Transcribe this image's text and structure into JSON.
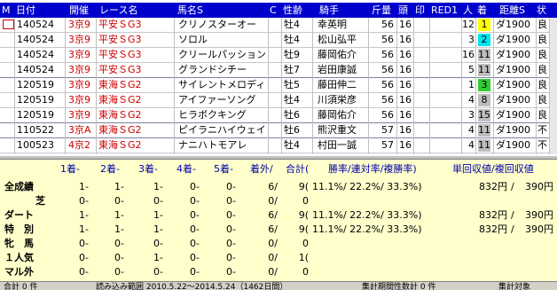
{
  "columns": {
    "m": "M",
    "date": "日付",
    "venue": "開催",
    "race": "レース名",
    "horse": "馬名S",
    "c": "C",
    "sexage": "性齢",
    "jockey": "騎手",
    "weight": "斤量",
    "head": "頭",
    "mark": "印",
    "red1": "RED1",
    "pop": "人",
    "finish": "着",
    "distance": "距離S",
    "cond": "状"
  },
  "colors": {
    "header_bg": "#0000cc",
    "first": "#ffff00",
    "second": "#00e5ee",
    "third": "#33cc33",
    "other": "#bdbdbd",
    "summary_bg": "#ffffcc"
  },
  "rows": [
    {
      "date": "140524",
      "venue": "3京9",
      "race": "平安ＳG3",
      "horse": "クリノスターオー",
      "sexage": "牡4",
      "jockey": "幸英明",
      "weight": "56",
      "head": "16",
      "pop": "12",
      "finish": "1",
      "distance": "ダ1900",
      "cond": "良",
      "finish_class": "b1"
    },
    {
      "date": "140524",
      "venue": "3京9",
      "race": "平安ＳG3",
      "horse": "ソロル",
      "sexage": "牡4",
      "jockey": "松山弘平",
      "weight": "56",
      "head": "16",
      "pop": "3",
      "finish": "2",
      "distance": "ダ1900",
      "cond": "良",
      "finish_class": "b2"
    },
    {
      "date": "140524",
      "venue": "3京9",
      "race": "平安ＳG3",
      "horse": "クリールパッション",
      "sexage": "牡9",
      "jockey": "藤岡佑介",
      "weight": "56",
      "head": "16",
      "pop": "16",
      "finish": "11",
      "distance": "ダ1900",
      "cond": "良",
      "finish_class": "bn"
    },
    {
      "date": "140524",
      "venue": "3京9",
      "race": "平安ＳG3",
      "horse": "グランドシチー",
      "sexage": "牡7",
      "jockey": "岩田康誠",
      "weight": "56",
      "head": "16",
      "pop": "5",
      "finish": "11",
      "distance": "ダ1900",
      "cond": "良",
      "finish_class": "bn"
    },
    {
      "date": "120519",
      "venue": "3京9",
      "race": "東海ＳG2",
      "horse": "サイレントメロディ",
      "sexage": "牡5",
      "jockey": "藤田伸二",
      "weight": "56",
      "head": "16",
      "pop": "1",
      "finish": "3",
      "distance": "ダ1900",
      "cond": "良",
      "finish_class": "b3"
    },
    {
      "date": "120519",
      "venue": "3京9",
      "race": "東海ＳG2",
      "horse": "アイファーソング",
      "sexage": "牡4",
      "jockey": "川須栄彦",
      "weight": "56",
      "head": "16",
      "pop": "4",
      "finish": "8",
      "distance": "ダ1900",
      "cond": "良",
      "finish_class": "bn"
    },
    {
      "date": "120519",
      "venue": "3京9",
      "race": "東海ＳG2",
      "horse": "ヒラボクキング",
      "sexage": "牡6",
      "jockey": "藤岡佑介",
      "weight": "56",
      "head": "16",
      "pop": "3",
      "finish": "15",
      "distance": "ダ1900",
      "cond": "良",
      "finish_class": "bn"
    },
    {
      "date": "110522",
      "venue": "3京A",
      "race": "東海ＳG2",
      "horse": "ピイラニハイウェイ",
      "sexage": "牡6",
      "jockey": "熊沢重文",
      "weight": "57",
      "head": "16",
      "pop": "4",
      "finish": "11",
      "distance": "ダ1900",
      "cond": "不",
      "finish_class": "bn"
    },
    {
      "date": "100523",
      "venue": "4京2",
      "race": "東海ＳG2",
      "horse": "ナニハトモアレ",
      "sexage": "牡4",
      "jockey": "村田一誠",
      "weight": "57",
      "head": "16",
      "pop": "4",
      "finish": "11",
      "distance": "ダ1900",
      "cond": "不",
      "finish_class": "bn"
    }
  ],
  "summary": {
    "headers": {
      "h1": "1着-",
      "h2": "2着-",
      "h3": "3着-",
      "h4": "4着-",
      "h5": "5着-",
      "h6": "着外/",
      "total": "合計(",
      "rates": "勝率/連対率/複勝率)",
      "ret": "単回収値/複回収値"
    },
    "rows": [
      {
        "label": "全成績",
        "c1": "1-",
        "c2": "1-",
        "c3": "1-",
        "c4": "0-",
        "c5": "0-",
        "c6": "6/",
        "total": "9(",
        "rates": "11.1%/ 22.2%/ 33.3%)",
        "win": "832円",
        "place": "390円",
        "sep": "/"
      },
      {
        "label": "芝",
        "c1": "0-",
        "c2": "0-",
        "c3": "0-",
        "c4": "0-",
        "c5": "0-",
        "c6": "0/",
        "total": "0",
        "rates": "",
        "win": "",
        "place": "",
        "sep": ""
      },
      {
        "label": "ダート",
        "c1": "1-",
        "c2": "1-",
        "c3": "1-",
        "c4": "0-",
        "c5": "0-",
        "c6": "6/",
        "total": "9(",
        "rates": "11.1%/ 22.2%/ 33.3%)",
        "win": "832円",
        "place": "390円",
        "sep": "/"
      },
      {
        "label": "特　別",
        "c1": "1-",
        "c2": "1-",
        "c3": "1-",
        "c4": "0-",
        "c5": "0-",
        "c6": "6/",
        "total": "9(",
        "rates": "11.1%/ 22.2%/ 33.3%)",
        "win": "832円",
        "place": "390円",
        "sep": "/"
      },
      {
        "label": "牝　馬",
        "c1": "0-",
        "c2": "0-",
        "c3": "0-",
        "c4": "0-",
        "c5": "0-",
        "c6": "0/",
        "total": "0",
        "rates": "",
        "win": "",
        "place": "",
        "sep": ""
      },
      {
        "label": "１人気",
        "c1": "0-",
        "c2": "0-",
        "c3": "1-",
        "c4": "0-",
        "c5": "0-",
        "c6": "0/",
        "total": "1(",
        "rates": "",
        "win": "",
        "place": "",
        "sep": ""
      },
      {
        "label": "マル外",
        "c1": "0-",
        "c2": "0-",
        "c3": "0-",
        "c4": "0-",
        "c5": "0-",
        "c6": "0/",
        "total": "0",
        "rates": "",
        "win": "",
        "place": "",
        "sep": ""
      }
    ]
  },
  "status": {
    "count": "合計 0 件",
    "range": "読み込み範囲 2010.5.22～2014.5.24（1462日間）",
    "period": "集計期間性数計 0 件",
    "agg": "集計対象"
  }
}
